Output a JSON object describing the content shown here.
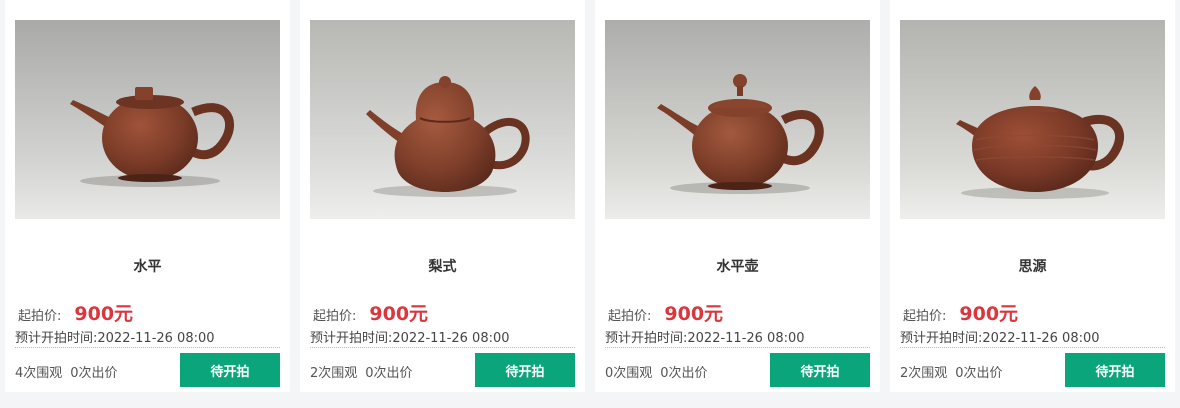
{
  "auction_lots": [
    {
      "title": "水平",
      "price_label": "起拍价:",
      "price": "900元",
      "start_time": "预计开拍时间:2022-11-26 08:00",
      "views": "4次围观",
      "bids": "0次出价",
      "status": "待开拍",
      "image_icon": "teapot-photo"
    },
    {
      "title": "梨式",
      "price_label": "起拍价:",
      "price": "900元",
      "start_time": "预计开拍时间:2022-11-26 08:00",
      "views": "2次围观",
      "bids": "0次出价",
      "status": "待开拍",
      "image_icon": "teapot-photo"
    },
    {
      "title": "水平壶",
      "price_label": "起拍价:",
      "price": "900元",
      "start_time": "预计开拍时间:2022-11-26 08:00",
      "views": "0次围观",
      "bids": "0次出价",
      "status": "待开拍",
      "image_icon": "teapot-photo"
    },
    {
      "title": "思源",
      "price_label": "起拍价:",
      "price": "900元",
      "start_time": "预计开拍时间:2022-11-26 08:00",
      "views": "2次围观",
      "bids": "0次出价",
      "status": "待开拍",
      "image_icon": "teapot-photo"
    }
  ],
  "colors": {
    "price": "#d9363e",
    "button": "#0aa57b",
    "teapot_clay": "#7a3b27"
  }
}
